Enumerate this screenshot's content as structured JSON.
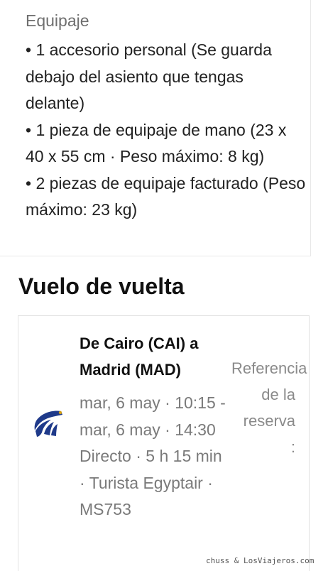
{
  "baggage": {
    "title": "Equipaje",
    "items": [
      "• 1 accesorio personal (Se guarda debajo del asiento que tengas delante)",
      "• 1 pieza de equipaje de mano (23 x 40 x 55 cm · Peso máximo: 8 kg)",
      "• 2 piezas de equipaje facturado (Peso máximo: 23 kg)"
    ]
  },
  "return_flight": {
    "heading": "Vuelo de vuelta",
    "route": "De Cairo (CAI) a Madrid (MAD)",
    "details": "mar, 6 may · 10:15 - mar, 6 may · 14:30 Directo · 5 h 15 min · Turista Egyptair · MS753",
    "booking_reference_label": "Referencia de la reserva",
    "booking_reference_colon": ":",
    "airline_icon": "egyptair-logo-icon",
    "airline_color": "#1f3a8a"
  },
  "watermark": "chuss & LosViajeros.com"
}
